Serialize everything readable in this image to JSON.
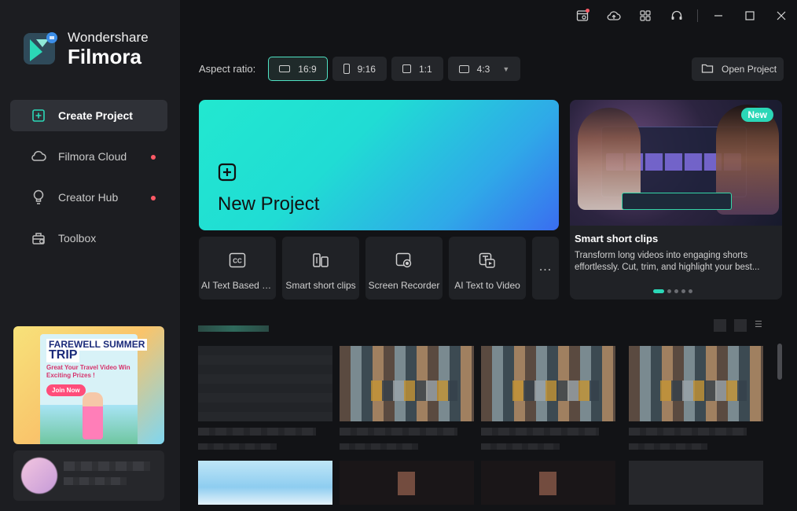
{
  "app": {
    "logo_line1": "Wondershare",
    "logo_line2": "Filmora",
    "accent": "#2bd7b7"
  },
  "sidebar": {
    "items": [
      {
        "label": "Create Project",
        "icon": "plus-square-icon",
        "active": true
      },
      {
        "label": "Filmora Cloud",
        "icon": "cloud-icon",
        "badge_dot": true
      },
      {
        "label": "Creator Hub",
        "icon": "bulb-icon",
        "badge_dot": true
      },
      {
        "label": "Toolbox",
        "icon": "toolbox-icon"
      }
    ],
    "promo": {
      "title1": "FAREWELL SUMMER",
      "title2": "TRIP",
      "subtitle": "Great Your Travel Video Win Exciting Prizes !",
      "button": "Join Now"
    }
  },
  "titlebar": {
    "icons": [
      "templates-icon",
      "cloud-upload-icon",
      "apps-grid-icon",
      "headset-icon",
      "minimize-icon",
      "maximize-icon",
      "close-icon"
    ]
  },
  "aspect": {
    "label": "Aspect ratio:",
    "options": [
      {
        "label": "16:9",
        "active": true
      },
      {
        "label": "9:16"
      },
      {
        "label": "1:1"
      },
      {
        "label": "4:3",
        "dropdown": true
      }
    ]
  },
  "open_project": {
    "label": "Open Project"
  },
  "new_project": {
    "label": "New Project"
  },
  "tools": [
    {
      "label": "AI Text Based E...",
      "icon": "cc-icon"
    },
    {
      "label": "Smart short clips",
      "icon": "smart-clips-icon"
    },
    {
      "label": "Screen Recorder",
      "icon": "screen-record-icon"
    },
    {
      "label": "AI Text to Video",
      "icon": "text-to-video-icon"
    }
  ],
  "tools_more": "...",
  "feature": {
    "badge": "New",
    "title": "Smart short clips",
    "desc_line1": "Transform long videos into engaging shorts",
    "desc_line2": "effortlessly. Cut, trim, and highlight your best...",
    "slides": 5,
    "active_slide": 1
  }
}
